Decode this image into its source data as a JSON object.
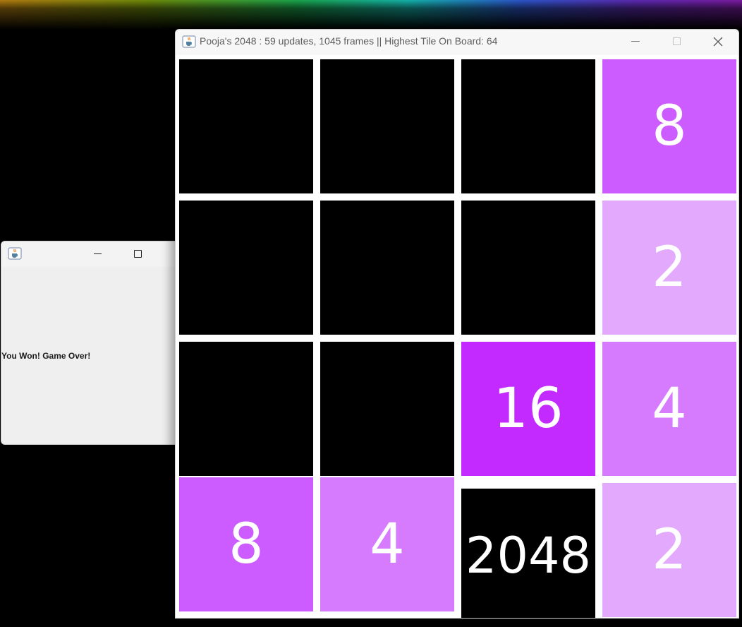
{
  "dialog": {
    "message": "You Won! Game Over!"
  },
  "game_window": {
    "title": "Pooja's 2048 : 59 updates, 1045 frames || Highest Tile On Board: 64",
    "controls": {
      "minimize": "minimize-icon",
      "maximize": "maximize-icon",
      "close": "close-icon"
    }
  },
  "board": {
    "rows": [
      [
        {
          "value": ""
        },
        {
          "value": ""
        },
        {
          "value": ""
        },
        {
          "value": "8"
        }
      ],
      [
        {
          "value": ""
        },
        {
          "value": ""
        },
        {
          "value": ""
        },
        {
          "value": "2"
        }
      ],
      [
        {
          "value": ""
        },
        {
          "value": ""
        },
        {
          "value": "16"
        },
        {
          "value": "4"
        }
      ],
      [
        {
          "value": "8"
        },
        {
          "value": "4"
        },
        {
          "value": "2048"
        },
        {
          "value": "2"
        }
      ]
    ]
  },
  "colors": {
    "empty": "#000000",
    "tile_2": "#e2a9fd",
    "tile_4": "#d67bfd",
    "tile_8": "#cc5cff",
    "tile_16": "#c22aff",
    "tile_2048": "#000000",
    "tile_text": "#ffffff"
  }
}
